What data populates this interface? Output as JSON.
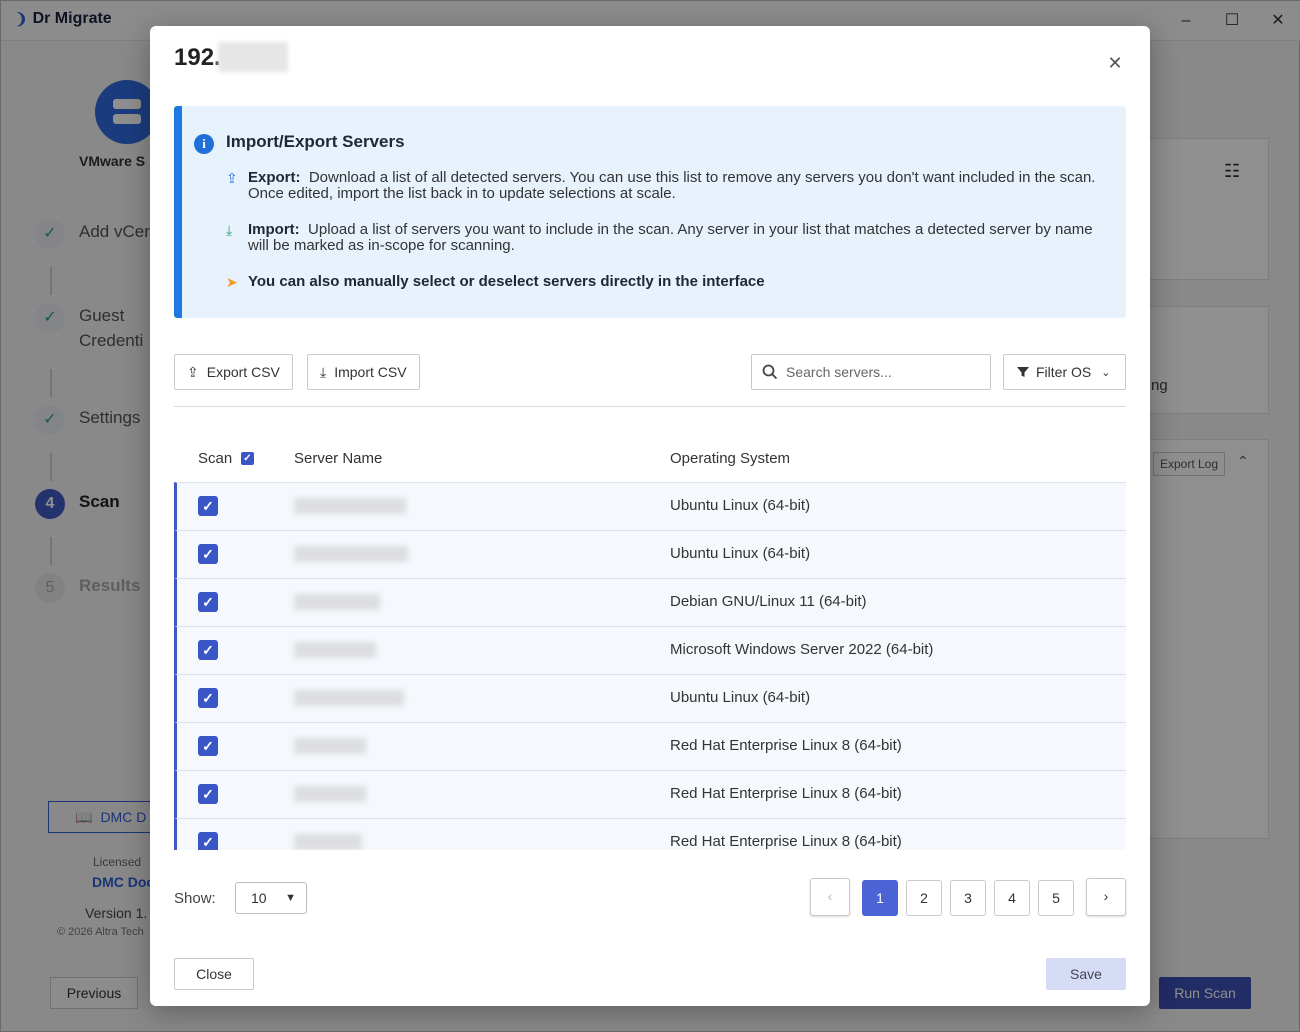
{
  "app": {
    "name": "Dr Migrate",
    "sidebar": {
      "connector_label": "VMware S",
      "steps": [
        {
          "number": "✓",
          "label": "Add vCer",
          "state": "done"
        },
        {
          "number": "✓",
          "label": "Guest Credenti",
          "state": "done"
        },
        {
          "number": "✓",
          "label": "Settings",
          "state": "done"
        },
        {
          "number": "4",
          "label": "Scan",
          "state": "active"
        },
        {
          "number": "5",
          "label": "Results",
          "state": "pending"
        }
      ],
      "doc_button": "DMC D",
      "licensed_label": "Licensed",
      "licensee": "DMC Doc",
      "version": "Version 1.",
      "copyright": "© 2026 Altra Tech"
    },
    "footer": {
      "previous": "Previous",
      "run_scan": "Run Scan"
    },
    "background": {
      "text_ng": "ng",
      "export_log": "Export Log"
    }
  },
  "modal": {
    "title": "192.",
    "info": {
      "title": "Import/Export Servers",
      "export_label": "Export:",
      "export_text": "Download a list of all detected servers. You can use this list to remove any servers you don't want included in the scan. Once edited, import the list back in to update selections at scale.",
      "import_label": "Import:",
      "import_text": "Upload a list of servers you want to include in the scan. Any server in your list that matches a detected server by name will be marked as in-scope for scanning.",
      "manual_text": "You can also manually select or deselect servers directly in the interface"
    },
    "toolbar": {
      "export_csv": "Export CSV",
      "import_csv": "Import CSV",
      "search_placeholder": "Search servers...",
      "filter_os": "Filter OS"
    },
    "table": {
      "headers": {
        "scan": "Scan",
        "server_name": "Server Name",
        "os": "Operating System"
      },
      "rows": [
        {
          "checked": true,
          "os": "Ubuntu Linux (64-bit)"
        },
        {
          "checked": true,
          "os": "Ubuntu Linux (64-bit)"
        },
        {
          "checked": true,
          "os": "Debian GNU/Linux 11 (64-bit)"
        },
        {
          "checked": true,
          "os": "Microsoft Windows Server 2022 (64-bit)"
        },
        {
          "checked": true,
          "os": "Ubuntu Linux (64-bit)"
        },
        {
          "checked": true,
          "os": "Red Hat Enterprise Linux 8 (64-bit)"
        },
        {
          "checked": true,
          "os": "Red Hat Enterprise Linux 8 (64-bit)"
        },
        {
          "checked": true,
          "os": "Red Hat Enterprise Linux 8 (64-bit)"
        }
      ]
    },
    "pagination": {
      "show_label": "Show:",
      "page_size": "10",
      "prev": "‹",
      "pages": [
        "1",
        "2",
        "3",
        "4",
        "5"
      ],
      "current_page": "1",
      "next": "›"
    },
    "footer": {
      "close": "Close",
      "save": "Save"
    }
  },
  "colors": {
    "accent": "#4b63d4",
    "info_border": "#1e7ae0",
    "info_bg": "#e8f2fd"
  }
}
